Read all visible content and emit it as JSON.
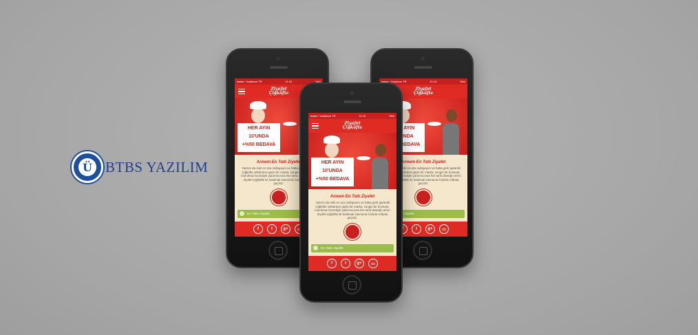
{
  "logo": {
    "text": "BTBS YAZILIM",
    "seal_text": "BARTIN ÜNİVERSİTESİ 2008",
    "seal_letter": "Ü"
  },
  "screen": {
    "carrier": "●●●●○ Vodafone TR",
    "time": "11:16",
    "battery": "%64",
    "app_logo_line1": "Ziyafet",
    "app_logo_line2": "Çiğköfte",
    "banner": [
      "HER AYIN",
      "10'UNDA",
      "+%50 BEDAVA"
    ],
    "title": "Annem En Tatlı Ziyafet",
    "body": "Yatırım da riski en aza indirgeyen ve hatta gelir garantili Çiğköfte sektörüne güçlü bir marka, zengin bir konsept, inanılmaz lezzetiyle yatırımcısına her türlü desteği veren Ziyafet Çiğköfte ile katılmak isterseniz bizimle irtibata geçiniz.",
    "list_item": "En Yakın Ziyafet",
    "social": {
      "facebook": "f",
      "twitter": "t",
      "gplus": "g+",
      "message": "▭"
    }
  }
}
